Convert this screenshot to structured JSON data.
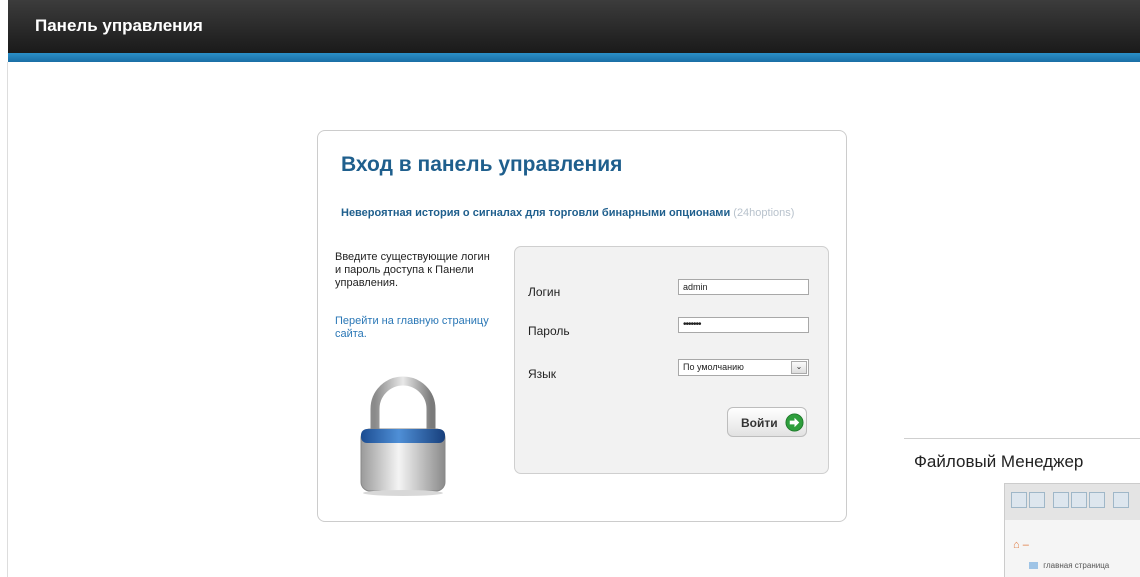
{
  "header": {
    "title": "Панель управления"
  },
  "login": {
    "title": "Вход в панель управления",
    "subtitle": "Невероятная история о сигналах для торговли бинарными опционами",
    "subtitle_muted": "(24hoptions)",
    "instructions": "Введите существующие логин и пароль доступа к Панели управления.",
    "home_link": "Перейти на главную страницу сайта.",
    "form": {
      "login_label": "Логин",
      "login_value": "admin",
      "password_label": "Пароль",
      "password_value": "•••••••",
      "language_label": "Язык",
      "language_value": "По умолчанию",
      "submit_label": "Войти"
    }
  },
  "file_manager": {
    "title": "Файловый Менеджер",
    "root": "⌂ –",
    "item": "главная страница"
  }
}
